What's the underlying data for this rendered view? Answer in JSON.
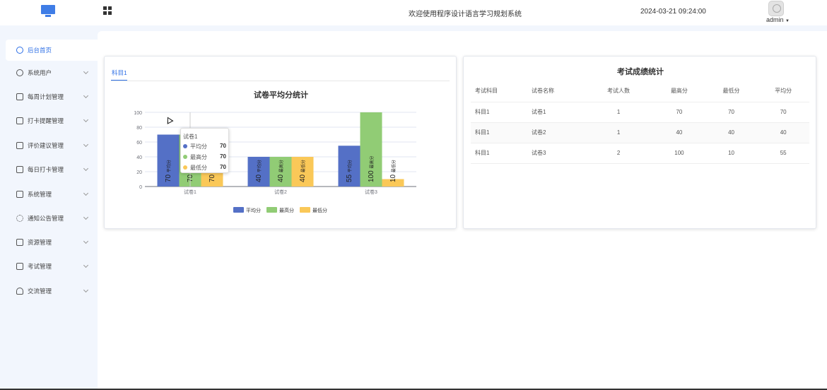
{
  "header": {
    "site_title": "欢迎使用程序设计语言学习规划系统",
    "datetime": "2024-03-21 09:24:00",
    "username": "admin"
  },
  "sidebar": {
    "items": [
      {
        "label": "后台首页",
        "icon": "clock-icon",
        "active": true
      },
      {
        "label": "系统用户",
        "icon": "user-icon"
      },
      {
        "label": "每周计划管理",
        "icon": "calendar-icon"
      },
      {
        "label": "打卡提醒管理",
        "icon": "calendar-icon"
      },
      {
        "label": "评价建议管理",
        "icon": "calendar-icon"
      },
      {
        "label": "每日打卡管理",
        "icon": "calendar-icon"
      },
      {
        "label": "系统管理",
        "icon": "folder-icon"
      },
      {
        "label": "通知公告管理",
        "icon": "sun-icon"
      },
      {
        "label": "资源管理",
        "icon": "printer-icon"
      },
      {
        "label": "考试管理",
        "icon": "puzzle-icon"
      },
      {
        "label": "交流管理",
        "icon": "headset-icon"
      }
    ]
  },
  "tabs": [
    {
      "label": "科目1"
    }
  ],
  "chart_data": {
    "type": "bar",
    "title": "试卷平均分统计",
    "categories": [
      "试卷1",
      "试卷2",
      "试卷3"
    ],
    "series": [
      {
        "name": "平均分",
        "values": [
          70,
          40,
          55
        ],
        "color": "#5470c6"
      },
      {
        "name": "最高分",
        "values": [
          70,
          40,
          100
        ],
        "color": "#91cc75"
      },
      {
        "name": "最低分",
        "values": [
          70,
          40,
          10
        ],
        "color": "#fac858"
      }
    ],
    "ylim": [
      0,
      100
    ],
    "yticks": [
      0,
      20,
      40,
      60,
      80,
      100
    ],
    "grid": true,
    "legend": "bottom-center"
  },
  "tooltip": {
    "title": "试卷1",
    "rows": [
      {
        "name": "平均分",
        "value": "70",
        "color": "#5470c6"
      },
      {
        "name": "最高分",
        "value": "70",
        "color": "#91cc75"
      },
      {
        "name": "最低分",
        "value": "70",
        "color": "#fac858"
      }
    ]
  },
  "table": {
    "title": "考试成绩统计",
    "headers": [
      "考试科目",
      "试卷名称",
      "考试人数",
      "最高分",
      "最低分",
      "平均分"
    ],
    "rows": [
      [
        "科目1",
        "试卷1",
        "1",
        "70",
        "70",
        "70"
      ],
      [
        "科目1",
        "试卷2",
        "1",
        "40",
        "40",
        "40"
      ],
      [
        "科目1",
        "试卷3",
        "2",
        "100",
        "10",
        "55"
      ]
    ]
  }
}
